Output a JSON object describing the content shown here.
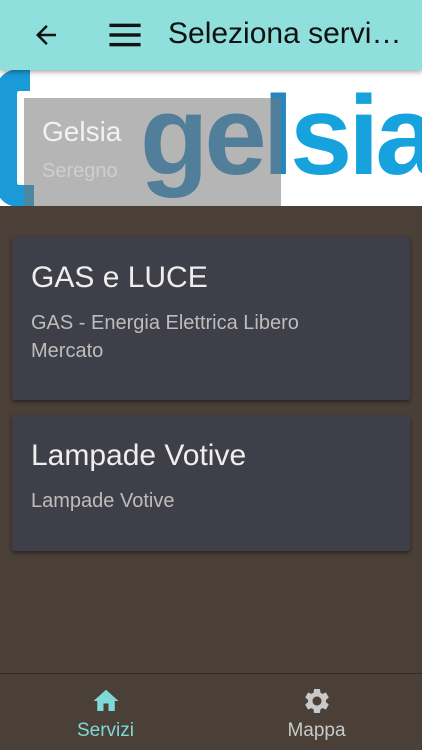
{
  "appbar": {
    "title": "Seleziona servizio",
    "back_icon": "arrow-left-icon",
    "menu_icon": "hamburger-menu-icon",
    "background": "#8fdfdc"
  },
  "banner": {
    "company": "Gelsia",
    "city": "Seregno",
    "logo_text": "gelsia",
    "logo_colors": {
      "gel": "#1f8fc9",
      "sia": "#1aa0d8"
    }
  },
  "services": [
    {
      "title": "GAS e LUCE",
      "subtitle": "GAS - Energia Elettrica Libero Mercato"
    },
    {
      "title": "Lampade Votive",
      "subtitle": "Lampade Votive"
    }
  ],
  "bottom_nav": {
    "items": [
      {
        "label": "Servizi",
        "icon": "home-icon",
        "active": true,
        "color": "#7fd9d6"
      },
      {
        "label": "Mappa",
        "icon": "gear-icon",
        "active": false,
        "color": "#c9c9c9"
      }
    ]
  }
}
